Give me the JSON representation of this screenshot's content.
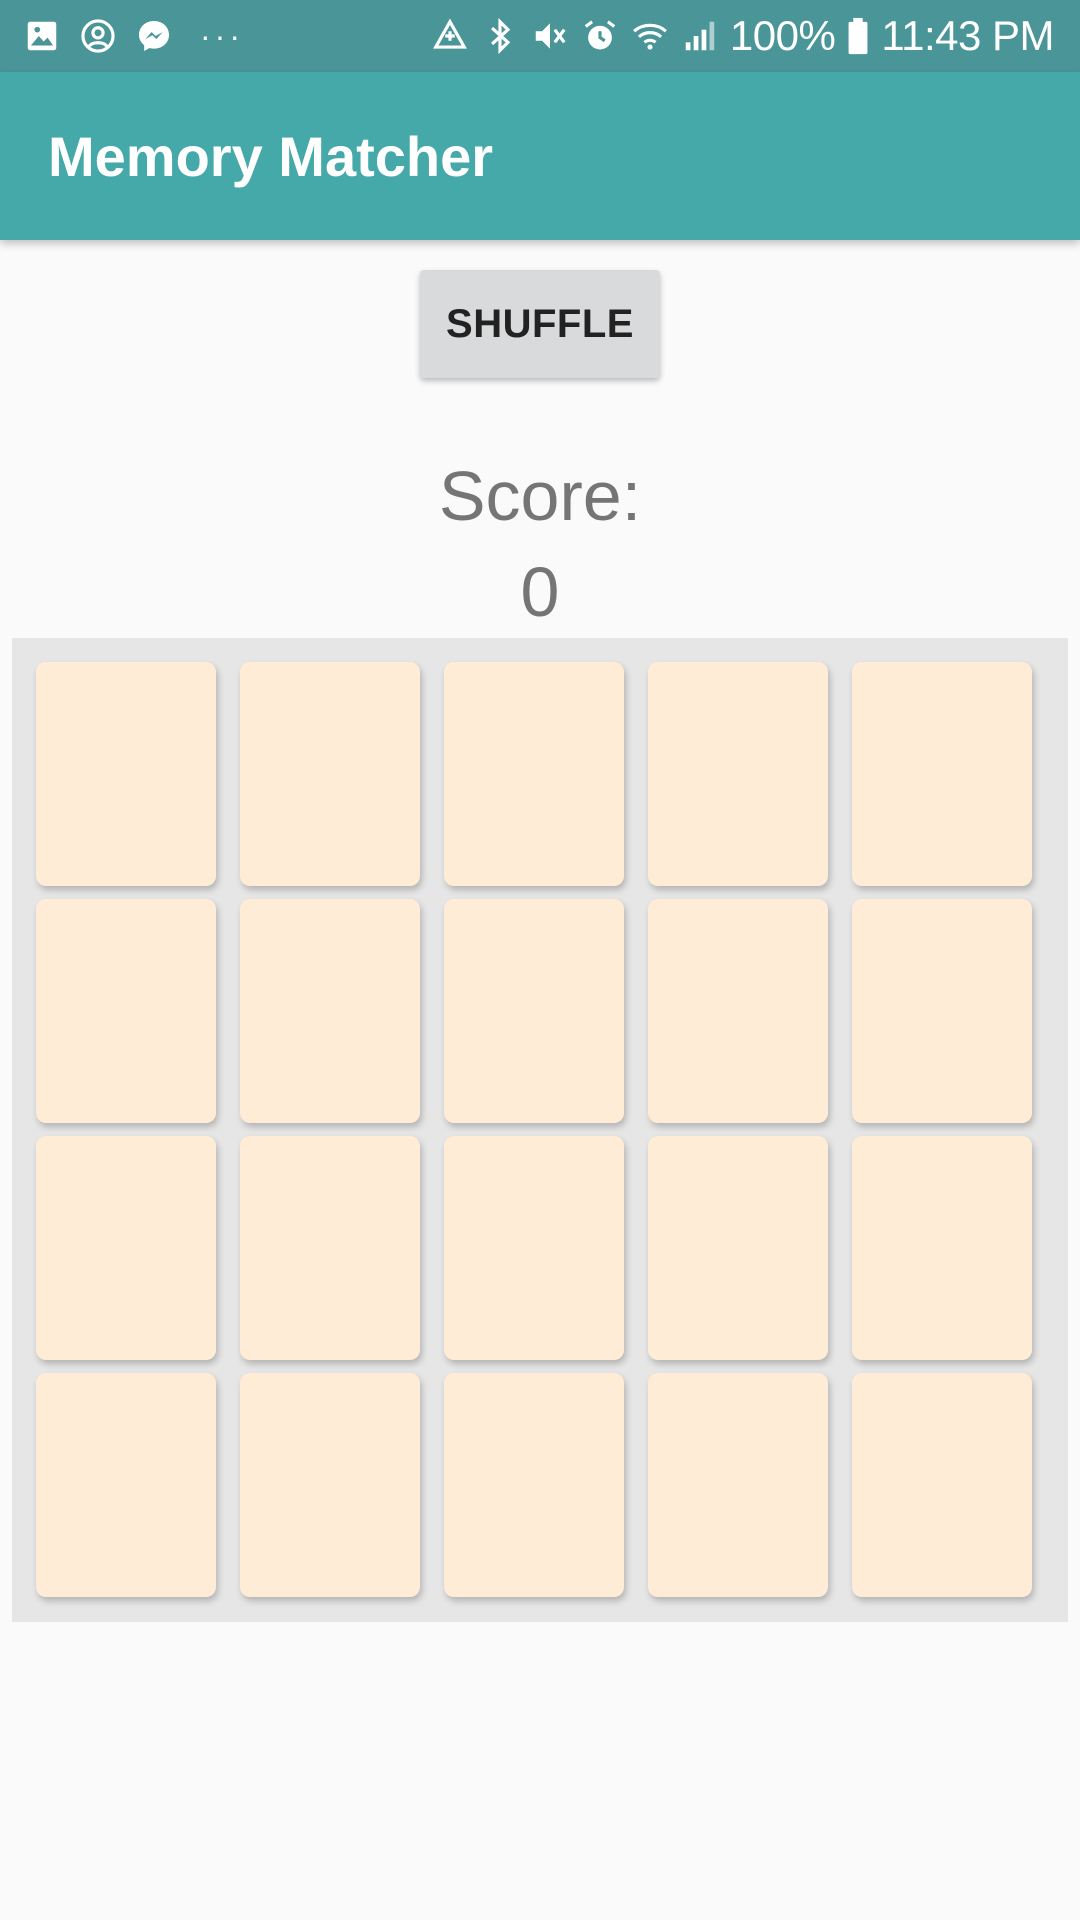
{
  "status_bar": {
    "icons_left": [
      "image-icon",
      "account-circle-icon",
      "messenger-icon"
    ],
    "overflow_dots": "···",
    "icons_right": [
      "data-saver-icon",
      "bluetooth-icon",
      "mute-icon",
      "alarm-icon",
      "wifi-icon",
      "cell-signal-icon"
    ],
    "battery_percent": "100%",
    "time": "11:43 PM"
  },
  "app_bar": {
    "title": "Memory Matcher",
    "color": "#44a9a8"
  },
  "controls": {
    "shuffle_label": "SHUFFLE"
  },
  "score": {
    "label": "Score:",
    "value": "0"
  },
  "board": {
    "rows": 4,
    "columns": 5,
    "card_color": "#ffecd7",
    "cards_face_down": 20
  }
}
